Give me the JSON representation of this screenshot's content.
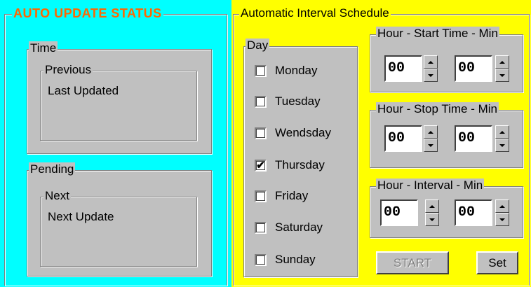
{
  "status_panel": {
    "title": "AUTO UPDATE STATUS",
    "time_group": {
      "label": "Time",
      "sub_label": "Previous",
      "value": "Last Updated"
    },
    "pending_group": {
      "label": "Pending",
      "sub_label": "Next",
      "value": "Next Update"
    }
  },
  "schedule_panel": {
    "title": "Automatic Interval Schedule",
    "day_group": {
      "label": "Day",
      "days": [
        {
          "label": "Monday",
          "checked": false
        },
        {
          "label": "Tuesday",
          "checked": false
        },
        {
          "label": "Wendsday",
          "checked": false
        },
        {
          "label": "Thursday",
          "checked": true
        },
        {
          "label": "Friday",
          "checked": false
        },
        {
          "label": "Saturday",
          "checked": false
        },
        {
          "label": "Sunday",
          "checked": false
        }
      ]
    },
    "start_time": {
      "label": "Hour - Start Time - Min",
      "hour": "00",
      "min": "00"
    },
    "stop_time": {
      "label": "Hour - Stop Time - Min",
      "hour": "00",
      "min": "00"
    },
    "interval": {
      "label": "Hour -  Interval  - Min",
      "hour": "00",
      "min": "00"
    },
    "start_button": {
      "label": "START",
      "enabled": false
    },
    "set_button": {
      "label": "Set"
    }
  },
  "check_mark": "✔",
  "colors": {
    "status_bg": "#00ffff",
    "schedule_bg": "#ffff00",
    "title_text": "#ff6600",
    "group_bg": "#c0c0c0"
  },
  "icons": {
    "spin_up": "triangle-up",
    "spin_down": "triangle-down"
  }
}
